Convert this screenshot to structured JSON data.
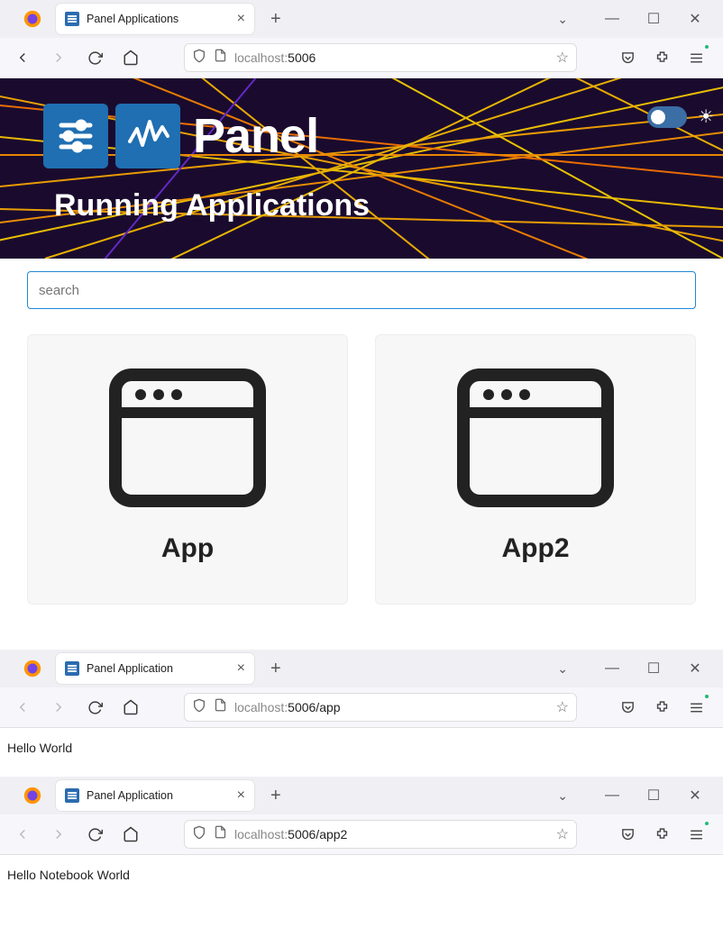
{
  "window_main": {
    "tab_title": "Panel Applications",
    "url_host": "localhost:",
    "url_path": "5006",
    "hero_title": "Panel",
    "hero_sub": "Running Applications",
    "search_placeholder": "search",
    "cards": [
      {
        "label": "App"
      },
      {
        "label": "App2"
      }
    ]
  },
  "window_app": {
    "tab_title": "Panel Application",
    "url_host": "localhost:",
    "url_path": "5006/app",
    "body": "Hello World"
  },
  "window_app2": {
    "tab_title": "Panel Application",
    "url_host": "localhost:",
    "url_path": "5006/app2",
    "body": "Hello Notebook World"
  }
}
